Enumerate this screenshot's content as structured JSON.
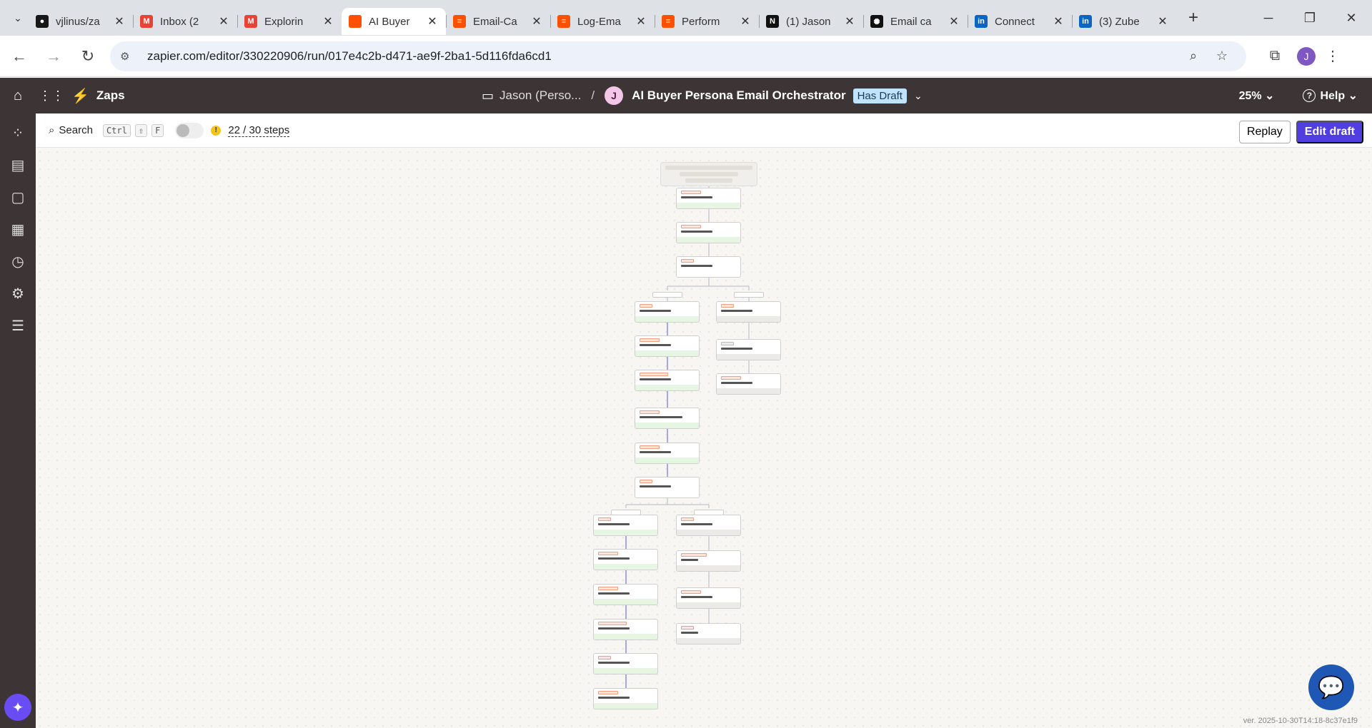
{
  "browser": {
    "tabs": [
      {
        "title": "vjlinus/za",
        "icon": "github-icon",
        "color": "#181717"
      },
      {
        "title": "Inbox (2",
        "icon": "gmail-icon",
        "color": "#ea4335"
      },
      {
        "title": "Explorin",
        "icon": "gmail-icon",
        "color": "#ea4335"
      },
      {
        "title": "AI Buyer",
        "icon": "zapier-icon",
        "color": "#ff4f00"
      },
      {
        "title": "Email-Ca",
        "icon": "zapier-tables-icon",
        "color": "#ff4f00"
      },
      {
        "title": "Log-Ema",
        "icon": "zapier-tables-icon",
        "color": "#ff4f00"
      },
      {
        "title": "Perform",
        "icon": "zapier-tables-icon",
        "color": "#ff4f00"
      },
      {
        "title": "(1) Jason",
        "icon": "notion-icon",
        "color": "#111111"
      },
      {
        "title": "Email ca",
        "icon": "openai-icon",
        "color": "#111111"
      },
      {
        "title": "Connect",
        "icon": "linkedin-icon",
        "color": "#0a66c2"
      },
      {
        "title": "(3) Zube",
        "icon": "linkedin-icon",
        "color": "#0a66c2"
      }
    ],
    "active_tab": 3,
    "url": "zapier.com/editor/330220906/run/017e4c2b-d471-ae9f-2ba1-5d116fda6cd1",
    "profile_initial": "J"
  },
  "header": {
    "app_name": "Zaps",
    "folder": "Jason (Perso...",
    "separator": "/",
    "owner_initial": "J",
    "zap_name": "AI Buyer Persona Email Orchestrator",
    "draft_badge": "Has Draft",
    "zoom": "25%",
    "help": "Help"
  },
  "toolbar": {
    "search_label": "Search",
    "kbd_ctrl": "Ctrl",
    "kbd_shift": "⇧",
    "kbd_f": "F",
    "warning": "!",
    "steps": "22 / 30 steps",
    "replay": "Replay",
    "edit_draft": "Edit draft"
  },
  "colors": {
    "brand": "#ff4f00",
    "primary_button": "#503ee0",
    "header_bg": "#3d3535",
    "success_footer": "#e6f6e2",
    "draft_badge": "#bfe4fb"
  },
  "canvas": {
    "steps_total": 30,
    "steps_shown": 22
  },
  "footer": {
    "version": "ver. 2025-10-30T14:18-8c37e1f9"
  }
}
